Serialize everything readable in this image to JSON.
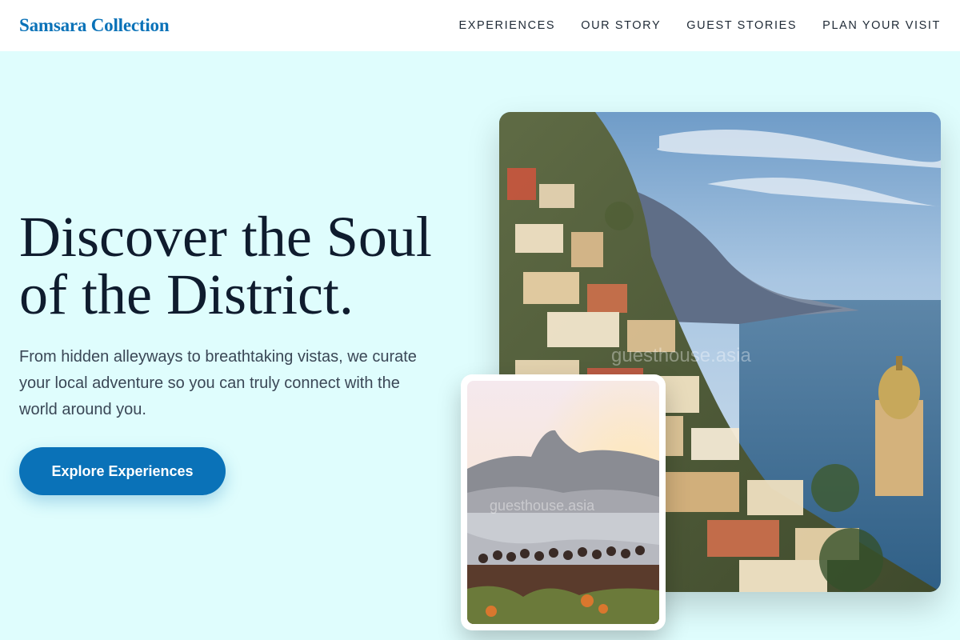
{
  "header": {
    "brand": "Samsara Collection",
    "nav": [
      {
        "label": "EXPERIENCES"
      },
      {
        "label": "OUR STORY"
      },
      {
        "label": "GUEST STORIES"
      },
      {
        "label": "PLAN YOUR VISIT"
      }
    ]
  },
  "hero": {
    "title_line1": "Discover the Soul",
    "title_line2": "of the District.",
    "subtitle": "From hidden alleyways to breathtaking vistas, we curate your local adventure so you can truly connect with the world around you.",
    "cta_label": "Explore Experiences"
  },
  "images": {
    "main": {
      "watermark": "guesthouse.asia"
    },
    "secondary": {
      "watermark": "guesthouse.asia"
    }
  },
  "colors": {
    "page_background": "#dffdfd",
    "header_background": "#ffffff",
    "brand": "#0a72b8",
    "accent": "#0a72b8",
    "heading": "#0f1c2e",
    "body_text": "#3a4756"
  }
}
